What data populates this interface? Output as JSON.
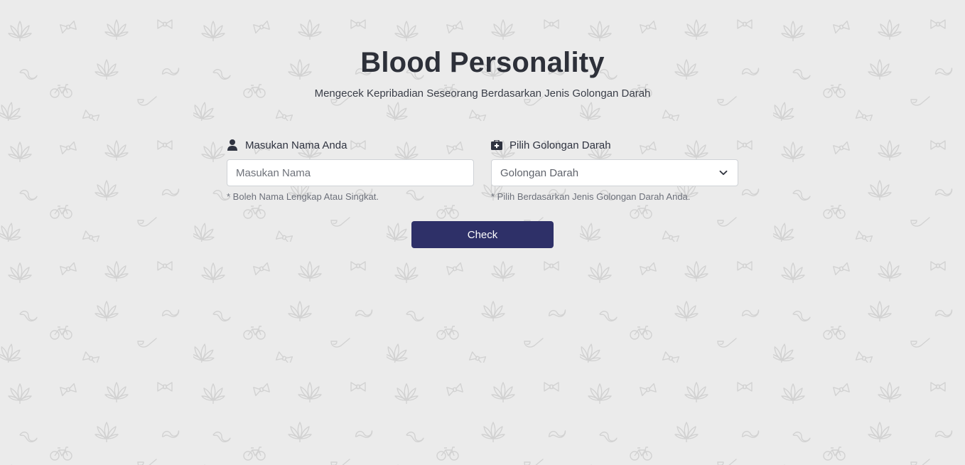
{
  "header": {
    "title": "Blood Personality",
    "subtitle": "Mengecek Kepribadian Seseorang Berdasarkan Jenis Golongan Darah"
  },
  "form": {
    "name": {
      "label": "Masukan Nama Anda",
      "icon": "user-icon",
      "placeholder": "Masukan Nama",
      "value": "",
      "hint": "* Boleh Nama Lengkap Atau Singkat."
    },
    "blood_type": {
      "label": "Pilih Golongan Darah",
      "icon": "medical-kit-icon",
      "selected": "Golongan Darah",
      "hint": "* Pilih Berdasarkan Jenis Golongan Darah Anda."
    },
    "submit_label": "Check"
  },
  "colors": {
    "background": "#ebebeb",
    "pattern": "#d3d3d3",
    "button": "#2e3068",
    "text": "#2d3039"
  }
}
